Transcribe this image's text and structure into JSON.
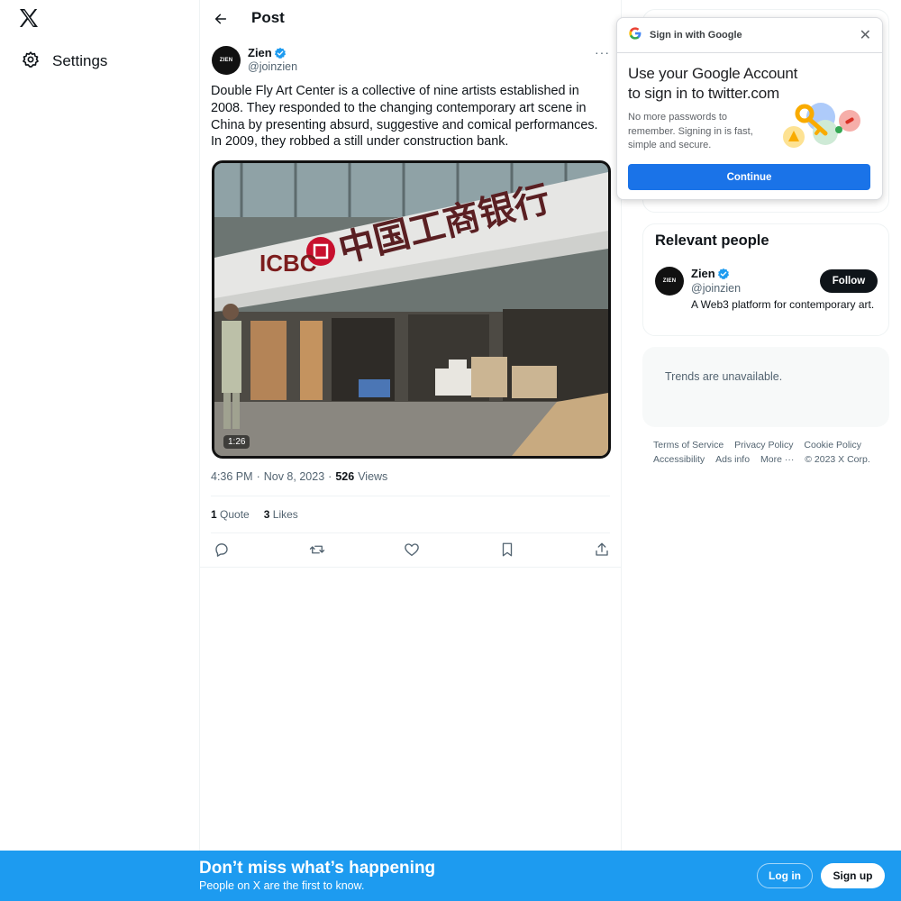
{
  "nav": {
    "settings_label": "Settings"
  },
  "header": {
    "title": "Post"
  },
  "post": {
    "author": {
      "name": "Zien",
      "handle": "@joinzien",
      "avatar_text": "ZIEN"
    },
    "text": "Double Fly Art Center is a collective of nine artists established in 2008. They responded to the changing contemporary art scene in China by presenting absurd, suggestive and comical performances. In 2009, they robbed a still under construction bank.",
    "media": {
      "duration": "1:26",
      "signage": "中国工商银行",
      "signage_brand": "ICBC"
    },
    "time": "4:36 PM",
    "date": "Nov 8, 2023",
    "views_count": "526",
    "views_label": "Views",
    "quotes_count": "1",
    "quotes_label": "Quote",
    "likes_count": "3",
    "likes_label": "Likes"
  },
  "google_popup": {
    "title": "Sign in with Google",
    "heading": "Use your Google Account to sign in to twitter.com",
    "description": "No more passwords to remember. Signing in is fast, simple and secure.",
    "continue_label": "Continue"
  },
  "relevant_people": {
    "title": "Relevant people",
    "person": {
      "name": "Zien",
      "handle": "@joinzien",
      "avatar_text": "ZIEN",
      "bio": "A Web3 platform for contemporary art."
    },
    "follow_label": "Follow"
  },
  "trends": {
    "text": "Trends are unavailable."
  },
  "footer": {
    "terms": "Terms of Service",
    "privacy": "Privacy Policy",
    "cookie": "Cookie Policy",
    "accessibility": "Accessibility",
    "ads": "Ads info",
    "more": "More ···",
    "copyright": "© 2023 X Corp."
  },
  "banner": {
    "title": "Don’t miss what’s happening",
    "subtitle": "People on X are the first to know.",
    "login_label": "Log in",
    "signup_label": "Sign up"
  },
  "colors": {
    "accent": "#1d9bf0",
    "google_blue": "#1a73e8",
    "text": "#0f1419",
    "muted": "#536471"
  }
}
